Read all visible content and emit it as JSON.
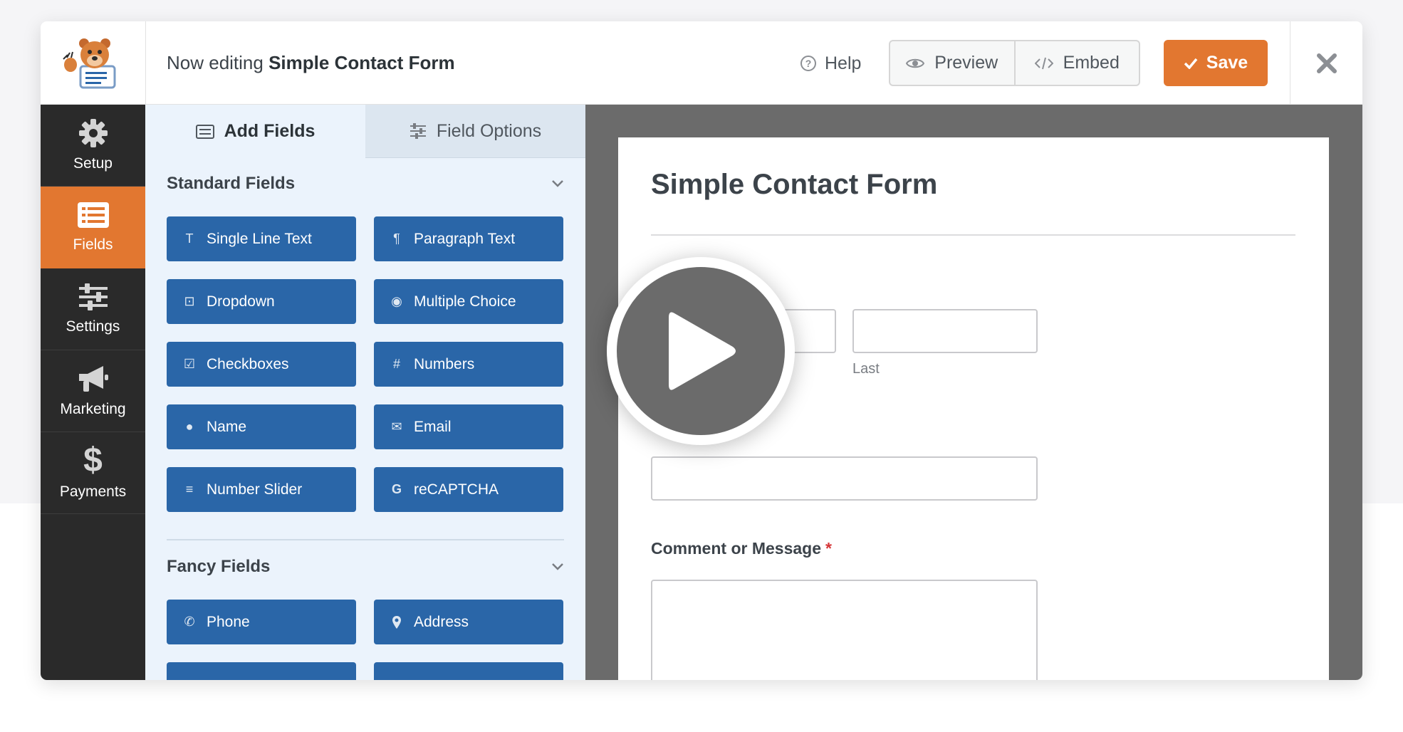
{
  "header": {
    "title_prefix": "Now editing",
    "form_name": "Simple Contact Form",
    "help_label": "Help",
    "preview_label": "Preview",
    "embed_label": "Embed",
    "save_label": "Save"
  },
  "sidebar": {
    "items": [
      {
        "label": "Setup",
        "icon": "gear-icon"
      },
      {
        "label": "Fields",
        "icon": "fields-list-icon",
        "active": true
      },
      {
        "label": "Settings",
        "icon": "sliders-icon"
      },
      {
        "label": "Marketing",
        "icon": "megaphone-icon"
      },
      {
        "label": "Payments",
        "icon": "dollar-icon"
      }
    ]
  },
  "panel": {
    "tabs": [
      {
        "label": "Add Fields",
        "active": true
      },
      {
        "label": "Field Options",
        "active": false
      }
    ],
    "standard_title": "Standard Fields",
    "standard_fields": [
      {
        "label": "Single Line Text",
        "icon": "text-icon"
      },
      {
        "label": "Paragraph Text",
        "icon": "paragraph-icon"
      },
      {
        "label": "Dropdown",
        "icon": "dropdown-icon"
      },
      {
        "label": "Multiple Choice",
        "icon": "radio-icon"
      },
      {
        "label": "Checkboxes",
        "icon": "checkbox-icon"
      },
      {
        "label": "Numbers",
        "icon": "hash-icon"
      },
      {
        "label": "Name",
        "icon": "user-icon"
      },
      {
        "label": "Email",
        "icon": "envelope-icon"
      },
      {
        "label": "Number Slider",
        "icon": "sliders-icon"
      },
      {
        "label": "reCAPTCHA",
        "icon": "google-icon"
      }
    ],
    "fancy_title": "Fancy Fields",
    "fancy_fields": [
      {
        "label": "Phone",
        "icon": "phone-icon"
      },
      {
        "label": "Address",
        "icon": "map-pin-icon"
      }
    ]
  },
  "preview": {
    "form_title": "Simple Contact Form",
    "last_sublabel": "Last",
    "message_label": "Comment or Message",
    "required_mark": "*"
  },
  "colors": {
    "accent": "#e27730",
    "field_button": "#2a66a8",
    "sidebar_bg": "#2a2a2a",
    "panel_bg": "#ebf3fc",
    "preview_bg": "#6b6b6b"
  }
}
